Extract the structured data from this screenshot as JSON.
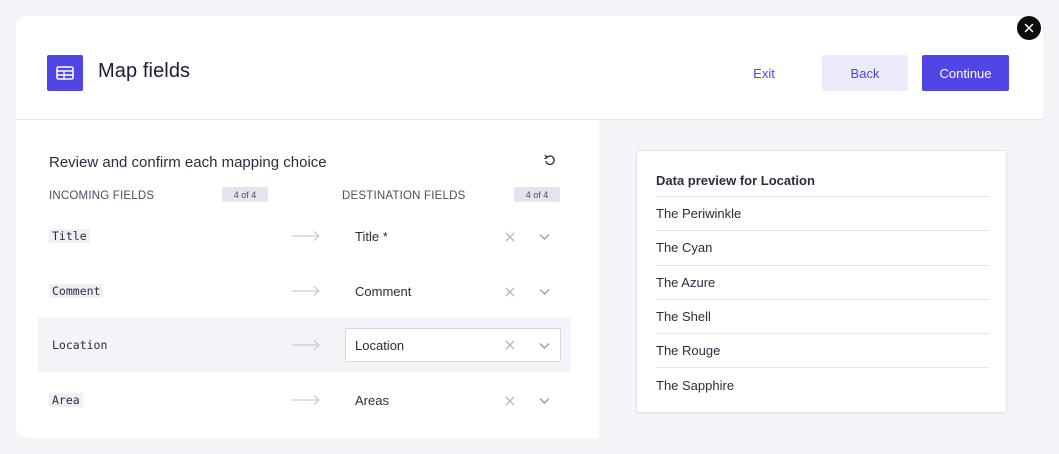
{
  "header": {
    "title": "Map fields",
    "exit_label": "Exit",
    "back_label": "Back",
    "continue_label": "Continue"
  },
  "colors": {
    "accent": "#4f46e5",
    "accent_light": "#ebebfb",
    "background": "#f4f5f9"
  },
  "mapping": {
    "heading": "Review and confirm each mapping choice",
    "incoming_label": "INCOMING FIELDS",
    "incoming_count": "4 of 4",
    "destination_label": "DESTINATION FIELDS",
    "destination_count": "4 of 4",
    "rows": [
      {
        "incoming": "Title",
        "destination": "Title *"
      },
      {
        "incoming": "Comment",
        "destination": "Comment"
      },
      {
        "incoming": "Location",
        "destination": "Location"
      },
      {
        "incoming": "Area",
        "destination": "Areas"
      }
    ]
  },
  "preview": {
    "title": "Data preview for Location",
    "items": [
      "The Periwinkle",
      "The Cyan",
      "The Azure",
      "The Shell",
      "The Rouge",
      "The Sapphire"
    ]
  },
  "icons": {
    "title": "table-icon",
    "close": "close-icon",
    "reset": "undo-icon",
    "arrow": "arrow-right-icon",
    "clear": "x-icon",
    "dropdown": "chevron-down-icon"
  }
}
